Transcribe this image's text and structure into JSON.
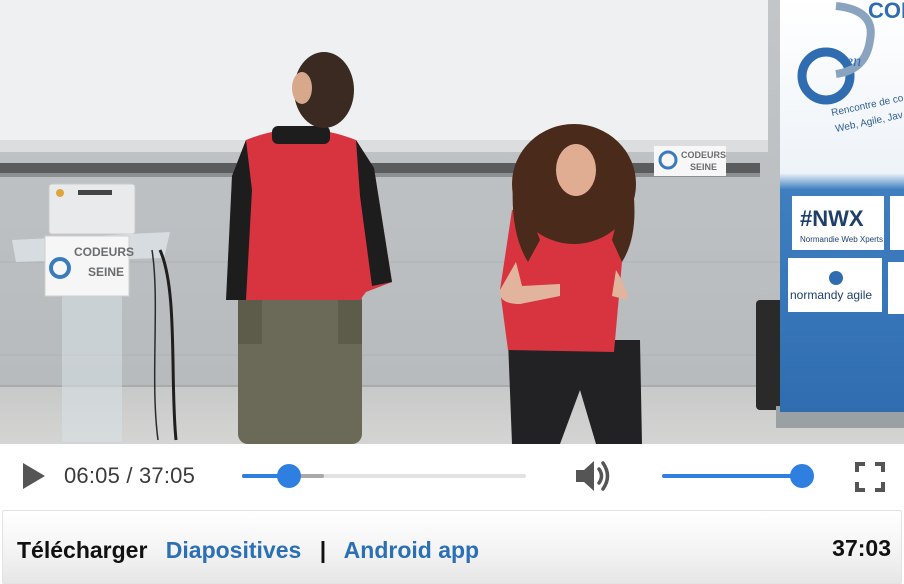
{
  "video": {
    "scene": "conference-talk",
    "podium_sign_line1": "CODEURS",
    "podium_sign_line2": "SEINE",
    "wall_sign_line1": "CODEURS",
    "wall_sign_line2": "SEINE",
    "banner": {
      "logo_text": "CODEURS",
      "logo_small": "en",
      "tagline_line1": "Rencontre de co",
      "tagline_line2": "Web, Agile, Jav",
      "sponsor1_name": "#NWX",
      "sponsor1_sub": "Normandie Web Xperts",
      "sponsor2_name": "normandy agile"
    }
  },
  "player": {
    "current_time": "06:05",
    "time_separator": "/",
    "total_time": "37:05",
    "progress_fraction": 0.164,
    "buffered_fraction": 0.29,
    "volume_fraction": 1.0,
    "accent_color": "#2f7fe0",
    "icons": [
      "play-icon",
      "volume-icon",
      "fullscreen-icon"
    ]
  },
  "info": {
    "download_label": "Télécharger",
    "slides_label": "Diapositives",
    "separator": "|",
    "android_label": "Android app",
    "duration": "37:03",
    "link_color": "#2b6fb5"
  }
}
